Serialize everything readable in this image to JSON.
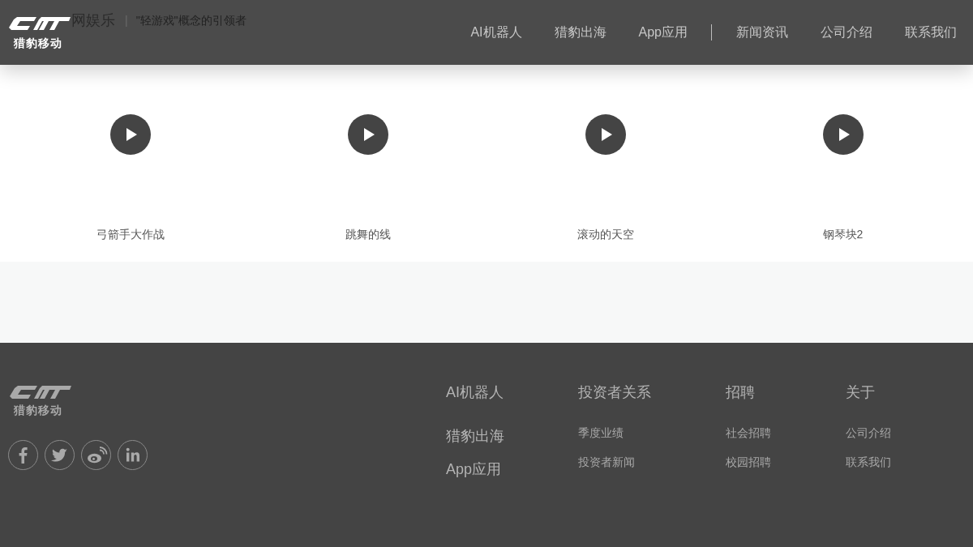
{
  "header": {
    "logo": {
      "caption": "猎豹移动"
    },
    "tagline": {
      "title": "网娱乐",
      "separator": "|",
      "slogan": "\"轻游戏\"概念的引领者"
    },
    "nav_groups": [
      {
        "items": [
          "AI机器人",
          "猎豹出海",
          "App应用"
        ]
      },
      {
        "items": [
          "新闻资讯",
          "公司介绍",
          "联系我们"
        ]
      }
    ]
  },
  "games": [
    {
      "title": "弓箭手大作战"
    },
    {
      "title": "跳舞的线"
    },
    {
      "title": "滚动的天空"
    },
    {
      "title": "钢琴块2"
    }
  ],
  "footer": {
    "logo": {
      "caption": "猎豹移动"
    },
    "products": [
      "AI机器人",
      "猎豹出海",
      "App应用"
    ],
    "columns": [
      {
        "heading": "投资者关系",
        "links": [
          "季度业绩",
          "投资者新闻"
        ]
      },
      {
        "heading": "招聘",
        "links": [
          "社会招聘",
          "校园招聘"
        ]
      },
      {
        "heading": "关于",
        "links": [
          "公司介绍",
          "联系我们"
        ]
      }
    ]
  }
}
